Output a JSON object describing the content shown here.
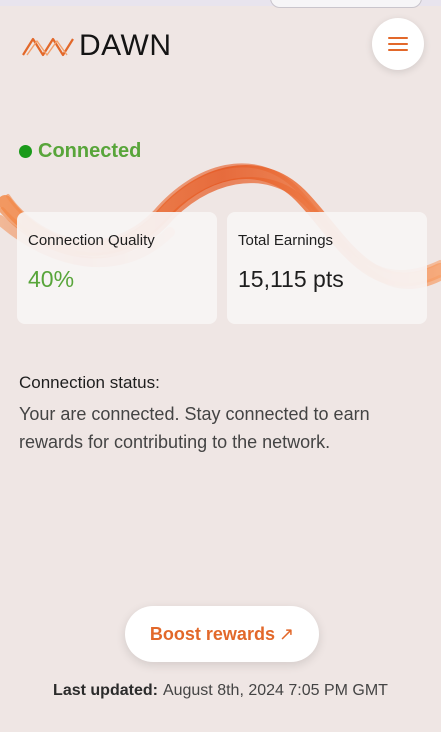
{
  "brand": {
    "name": "DAWN",
    "accent": "#e2682a",
    "logo_icon": "wave-logo-icon"
  },
  "header": {
    "menu_icon": "hamburger-menu-icon"
  },
  "status": {
    "label": "Connected",
    "color": "#58a53a",
    "dot_color": "#1a9a1a"
  },
  "cards": {
    "quality": {
      "title": "Connection Quality",
      "value": "40%"
    },
    "earnings": {
      "title": "Total Earnings",
      "value": "15,115 pts"
    }
  },
  "connection": {
    "heading": "Connection status:",
    "text": "Your are connected. Stay connected to earn rewards for contributing to the network."
  },
  "boost": {
    "label": "Boost rewards",
    "arrow": "↗"
  },
  "updated": {
    "label": "Last updated:",
    "value": "August 8th, 2024 7:05 PM GMT"
  }
}
